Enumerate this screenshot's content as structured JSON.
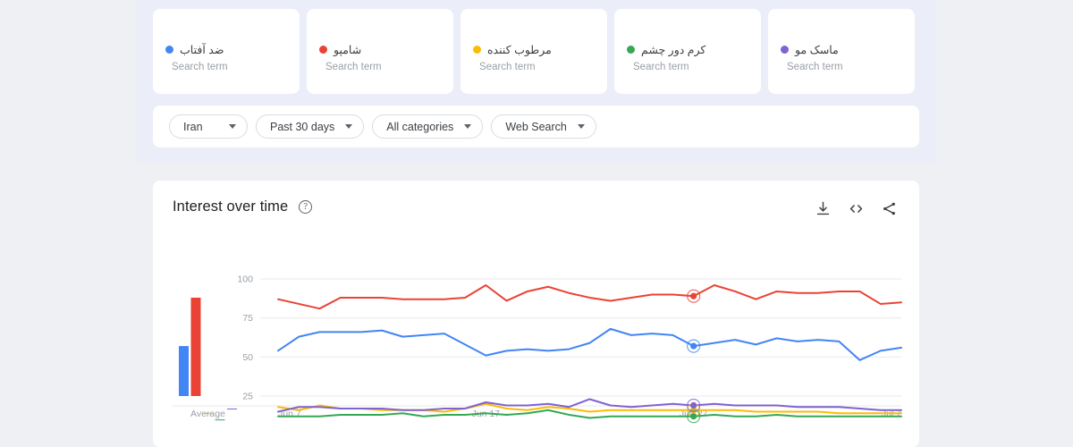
{
  "terms": [
    {
      "name": "ضد آفتاب",
      "type": "Search term",
      "color": "#4285f4"
    },
    {
      "name": "شامپو",
      "type": "Search term",
      "color": "#ea4335"
    },
    {
      "name": "مرطوب کننده",
      "type": "Search term",
      "color": "#fbbc04"
    },
    {
      "name": "کرم دور چشم",
      "type": "Search term",
      "color": "#34a853"
    },
    {
      "name": "ماسک مو",
      "type": "Search term",
      "color": "#7f63d2"
    }
  ],
  "filters": [
    {
      "label": "Iran"
    },
    {
      "label": "Past 30 days"
    },
    {
      "label": "All categories"
    },
    {
      "label": "Web Search"
    }
  ],
  "chart_card": {
    "title": "Interest over time",
    "help_icon": "question-mark",
    "actions": [
      {
        "name": "download",
        "label": "Download CSV"
      },
      {
        "name": "embed",
        "label": "Embed"
      },
      {
        "name": "share",
        "label": "Share"
      }
    ]
  },
  "chart_data": {
    "type": "line",
    "title": "Interest over time",
    "xlabel": "",
    "ylabel": "",
    "ylim": [
      0,
      105
    ],
    "yticks": [
      25,
      50,
      75,
      100
    ],
    "grid": true,
    "legend": "top-cards",
    "xticks": [
      "Jun 7",
      "Jun 17",
      "Jun 27",
      "Jul 7"
    ],
    "xtick_index": [
      0,
      10,
      20,
      30
    ],
    "x": [
      "Jun 7",
      "Jun 8",
      "Jun 9",
      "Jun 10",
      "Jun 11",
      "Jun 12",
      "Jun 13",
      "Jun 14",
      "Jun 15",
      "Jun 16",
      "Jun 17",
      "Jun 18",
      "Jun 19",
      "Jun 20",
      "Jun 21",
      "Jun 22",
      "Jun 23",
      "Jun 24",
      "Jun 25",
      "Jun 26",
      "Jun 27",
      "Jun 28",
      "Jun 29",
      "Jun 30",
      "Jul 1",
      "Jul 2",
      "Jul 3",
      "Jul 4",
      "Jul 5",
      "Jul 6",
      "Jul 7"
    ],
    "highlight_index": 20,
    "highlight_label": "Jun 27",
    "series": [
      {
        "name": "ضد آفتاب",
        "color": "#4285f4",
        "average": 57,
        "values": [
          54,
          63,
          66,
          66,
          66,
          67,
          63,
          64,
          65,
          58,
          51,
          54,
          55,
          54,
          55,
          59,
          68,
          64,
          65,
          64,
          57,
          59,
          61,
          58,
          62,
          60,
          61,
          60,
          48,
          54,
          56
        ]
      },
      {
        "name": "شامپو",
        "color": "#ea4335",
        "average": 88,
        "values": [
          87,
          84,
          81,
          88,
          88,
          88,
          87,
          87,
          87,
          88,
          96,
          86,
          92,
          95,
          91,
          88,
          86,
          88,
          90,
          90,
          89,
          96,
          92,
          87,
          92,
          91,
          91,
          92,
          92,
          84,
          85
        ]
      },
      {
        "name": "مرطوب کننده",
        "color": "#fbbc04",
        "average": 14,
        "values": [
          18,
          16,
          19,
          17,
          17,
          16,
          16,
          16,
          15,
          17,
          20,
          17,
          16,
          18,
          17,
          15,
          16,
          16,
          16,
          16,
          16,
          16,
          16,
          15,
          15,
          15,
          15,
          14,
          14,
          14,
          14
        ]
      },
      {
        "name": "کرم دور چشم",
        "color": "#34a853",
        "average": 10,
        "values": [
          12,
          12,
          12,
          13,
          13,
          13,
          14,
          12,
          13,
          13,
          14,
          13,
          14,
          16,
          13,
          11,
          12,
          12,
          12,
          12,
          12,
          13,
          12,
          12,
          13,
          12,
          12,
          12,
          12,
          12,
          12
        ]
      },
      {
        "name": "ماسک مو",
        "color": "#7f63d2",
        "average": 17,
        "values": [
          15,
          18,
          18,
          17,
          17,
          17,
          16,
          16,
          17,
          17,
          21,
          19,
          19,
          20,
          18,
          23,
          19,
          18,
          19,
          20,
          19,
          20,
          19,
          19,
          19,
          18,
          18,
          18,
          17,
          16,
          16
        ]
      }
    ],
    "average_panel_label": "Average"
  }
}
